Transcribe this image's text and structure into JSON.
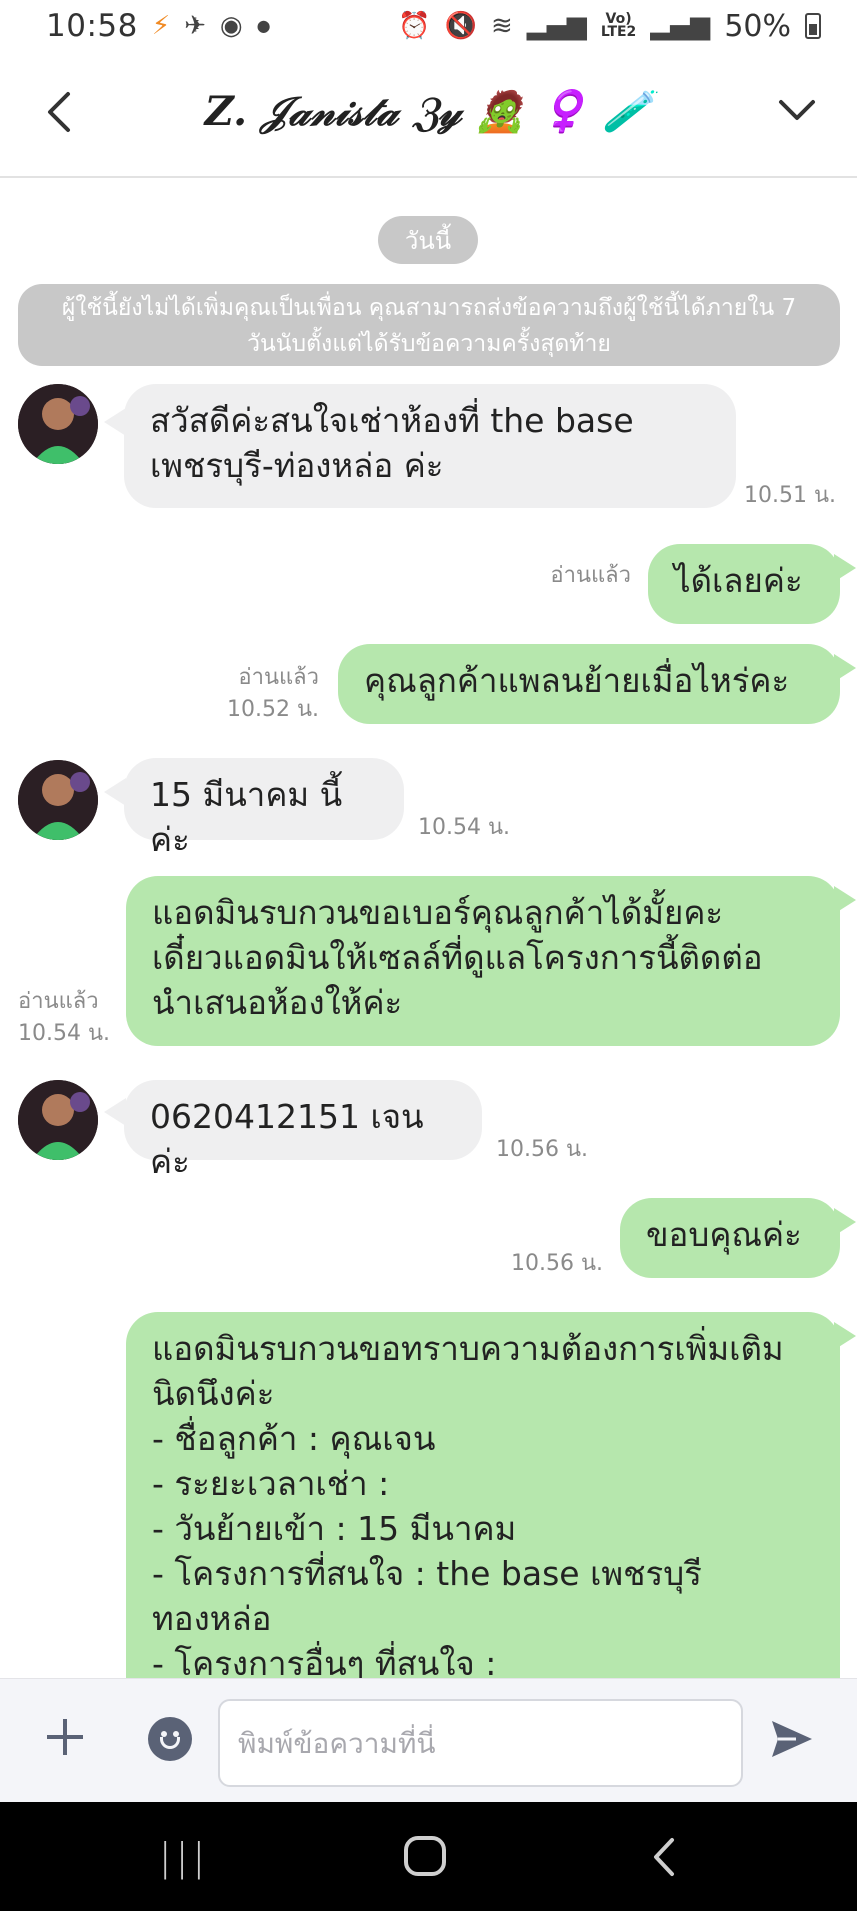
{
  "status_bar": {
    "time": "10:58",
    "battery": "50%",
    "network": "Vo)\nLTE2",
    "icons": [
      "line-notification-icon",
      "telegram-icon",
      "messenger-icon",
      "dot-icon",
      "alarm-icon",
      "mute-icon",
      "wifi-icon",
      "signal-icon",
      "volte-icon",
      "signal-icon",
      "battery-icon"
    ]
  },
  "header": {
    "title": "Z. 𝒥𝒶𝓃𝒾𝓈𝓉𝒶 ℨ𝓎 🧟 ♀️ 🧪"
  },
  "chat": {
    "date_pill": "วันนี้",
    "notice": "ผู้ใช้นี้ยังไม่ได้เพิ่มคุณเป็นเพื่อน คุณสามารถส่งข้อความถึงผู้ใช้นี้ได้ภายใน 7 วันนับตั้งแต่ได้รับข้อความครั้งสุดท้าย",
    "messages": [
      {
        "side": "in",
        "lines": [
          "สวัสดีค่ะสนใจเช่าห้องที่ the base",
          "เพชรบุรี-ท่องหล่อ ค่ะ"
        ],
        "time": "10.51 น."
      },
      {
        "side": "out",
        "lines": [
          "ได้เลยค่ะ"
        ],
        "read": "อ่านแล้ว",
        "time": ""
      },
      {
        "side": "out",
        "lines": [
          "คุณลูกค้าแพลนย้ายเมื่อไหร่คะ"
        ],
        "read": "อ่านแล้ว",
        "time": "10.52 น."
      },
      {
        "side": "in",
        "lines": [
          "15 มีนาคม นี้ค่ะ"
        ],
        "time": "10.54 น."
      },
      {
        "side": "out",
        "lines": [
          "แอดมินรบกวนขอเบอร์คุณลูกค้าได้มั้ยคะ",
          "เดี๋ยวแอดมินให้เซลล์ที่ดูแลโครงการนี้ติดต่อ",
          "นำเสนอห้องให้ค่ะ"
        ],
        "read": "อ่านแล้ว",
        "time": "10.54 น."
      },
      {
        "side": "in",
        "lines": [
          "0620412151 เจนค่ะ"
        ],
        "time": "10.56 น."
      },
      {
        "side": "out",
        "lines": [
          "ขอบคุณค่ะ"
        ],
        "read": "",
        "time": "10.56 น."
      },
      {
        "side": "out",
        "lines": [
          "แอดมินรบกวนขอทราบความต้องการเพิ่มเติม",
          "นิดนึงค่ะ",
          "- ชื่อลูกค้า : คุณเจน",
          "- ระยะเวลาเช่า :",
          "- วันย้ายเข้า : 15 มีนาคม",
          "- โครงการที่สนใจ : the base เพชรบุรี",
          "ทองหล่อ",
          "- โครงการอื่นๆ ที่สนใจ :"
        ],
        "read": "",
        "time": ""
      }
    ]
  },
  "input_bar": {
    "placeholder": "พิมพ์ข้อความที่นี่"
  },
  "nav_bar": {
    "recent_label": "|||"
  }
}
